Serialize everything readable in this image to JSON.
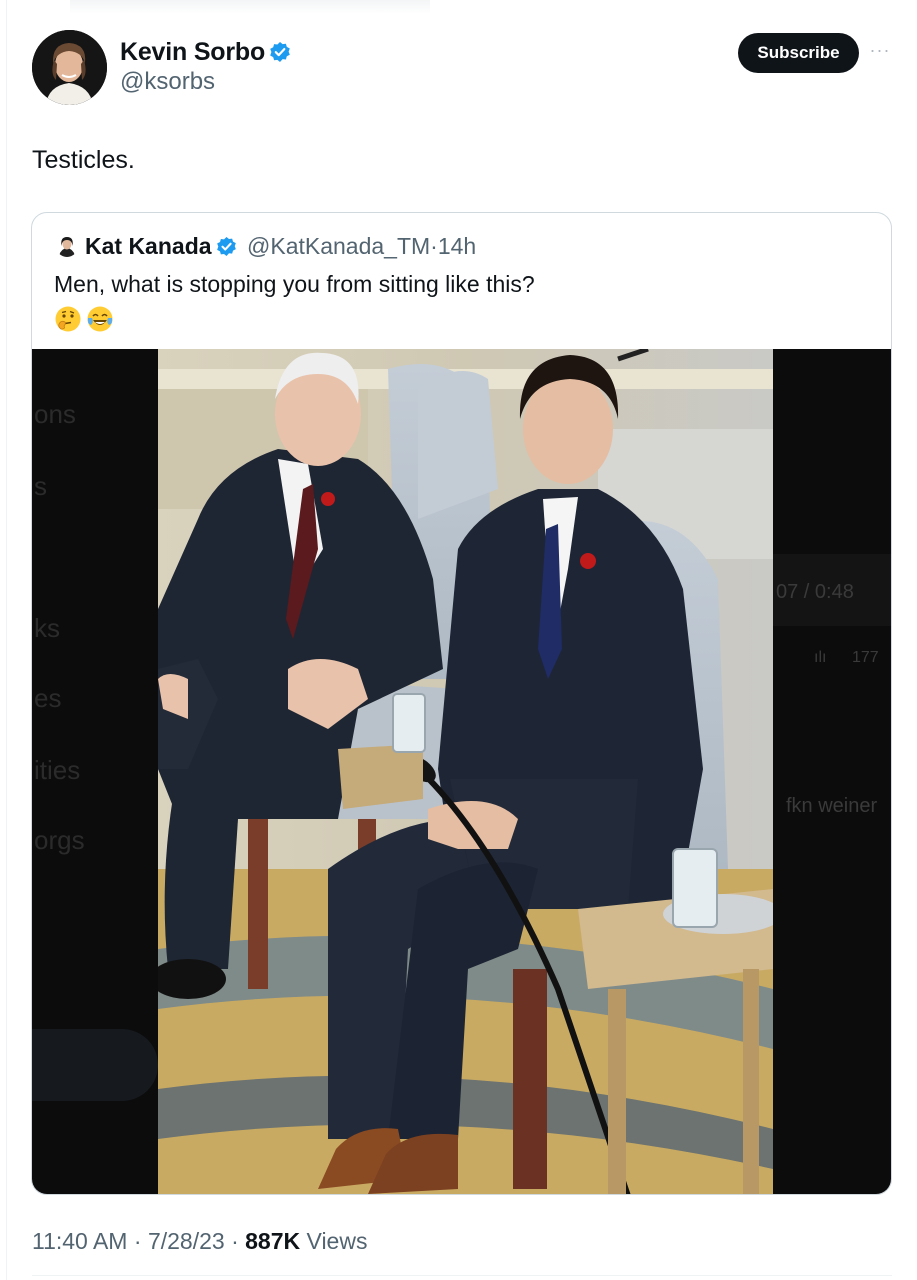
{
  "author": {
    "name": "Kevin Sorbo",
    "handle": "@ksorbs",
    "verified": true
  },
  "actions": {
    "subscribe_label": "Subscribe",
    "more_label": "···"
  },
  "tweet": {
    "text": "Testicles."
  },
  "quote": {
    "name": "Kat Kanada",
    "handle": "@KatKanada_TM",
    "time": "14h",
    "text": "Men, what is stopping you from sitting like this?",
    "emojis": [
      "thinking-face-icon",
      "tears-of-joy-icon"
    ],
    "background_fragments": {
      "left": [
        "ons",
        "s",
        "ks",
        "es",
        "ities",
        "orgs"
      ],
      "right_time": "07 / 0:48",
      "right_views": "177",
      "right_text": "fkn weiner"
    }
  },
  "footer": {
    "time": "11:40 AM",
    "date": "7/28/23",
    "views_count": "887K",
    "views_label": "Views",
    "sep": "·"
  },
  "colors": {
    "verified_blue": "#1d9bf0",
    "muted_text": "#536471",
    "primary_text": "#0f1419",
    "border": "#cfd9de"
  }
}
